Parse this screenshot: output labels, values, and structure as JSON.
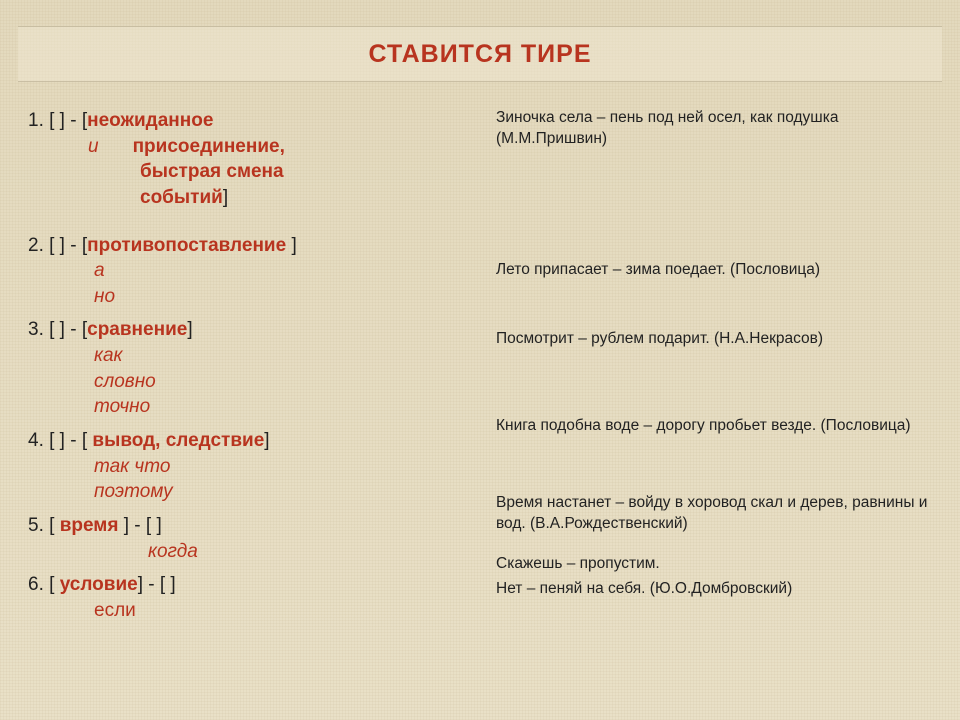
{
  "title": "СТАВИТСЯ  ТИРЕ",
  "rules": {
    "r1": {
      "head": "1.  [   ]  -  [",
      "key1": "неожиданное",
      "conj": "и",
      "key2": "присоединение,",
      "key3": "быстрая смена",
      "key4": "событий",
      "close": "]"
    },
    "r2": {
      "head": "2.   [   ]  -  [",
      "key": "противопоставление ",
      "close": "]",
      "sub1": "а",
      "sub2": "но"
    },
    "r3": {
      "head": "3.     [      ]   -   [",
      "key": "сравнение",
      "close": "]",
      "sub1": "как",
      "sub2": "словно",
      "sub3": "точно"
    },
    "r4": {
      "head": "4.     [      ]  -  [ ",
      "key": "вывод, следствие",
      "close": "]",
      "sub1": "так что",
      "sub2": "поэтому"
    },
    "r5": {
      "head": "5.     [ ",
      "key": "время",
      "head2": " ]  -  [   ]",
      "sub1": "когда"
    },
    "r6": {
      "head": "6.     [ ",
      "key": "условие",
      "head2": "]  -  [   ]",
      "sub1": "если"
    }
  },
  "examples": {
    "e1": "Зиночка села – пень под ней осел, как подушка (М.М.Пришвин)",
    "e2": "Лето припасает – зима поедает. (Пословица)",
    "e3": "Посмотрит – рублем подарит. (Н.А.Некрасов)",
    "e4": "Книга подобна воде – дорогу пробьет везде. (Пословица)",
    "e5": "Время настанет – войду в хоровод скал и дерев, равнины и вод. (В.А.Рождественский)",
    "e6a": "Скажешь – пропустим.",
    "e6b": "Нет – пеняй на себя. (Ю.О.Домбровский)"
  }
}
